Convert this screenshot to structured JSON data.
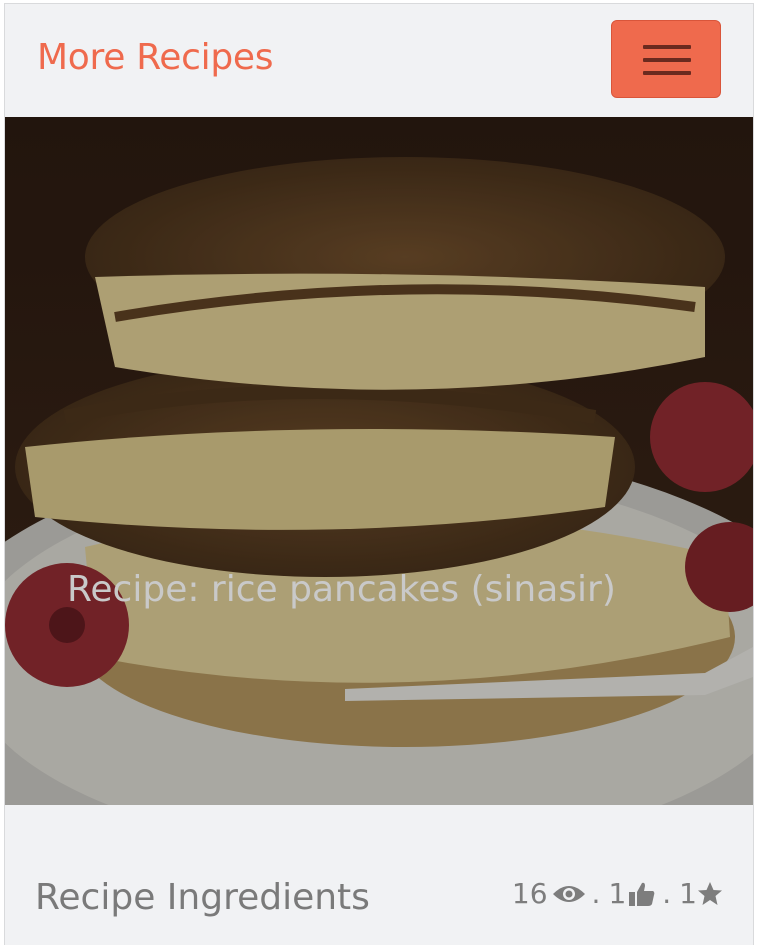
{
  "navbar": {
    "brand": "More Recipes",
    "menu_icon": "hamburger-icon"
  },
  "hero": {
    "caption": "Recipe: rice pancakes (sinasir)"
  },
  "details": {
    "section_title": "Recipe Ingredients",
    "stats": {
      "views": "16",
      "likes": "1",
      "favorites": "1",
      "separator": "."
    },
    "icons": [
      "eye-icon",
      "thumbs-up-icon",
      "star-icon"
    ]
  },
  "colors": {
    "brand": "#ef6a4d",
    "background": "#f1f2f4",
    "muted_text": "#7a7a7a"
  }
}
